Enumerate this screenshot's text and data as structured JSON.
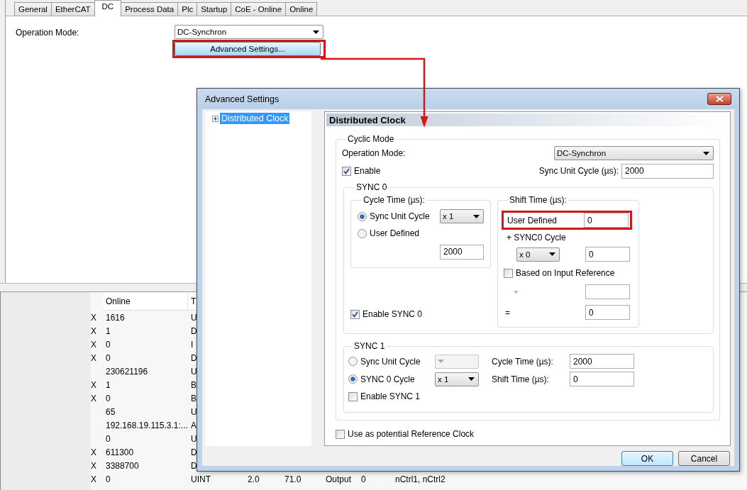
{
  "tabs": [
    {
      "label": "General",
      "selected": false
    },
    {
      "label": "EtherCAT",
      "selected": false
    },
    {
      "label": "DC",
      "selected": true
    },
    {
      "label": "Process Data",
      "selected": false
    },
    {
      "label": "Plc",
      "selected": false
    },
    {
      "label": "Startup",
      "selected": false
    },
    {
      "label": "CoE - Online",
      "selected": false
    },
    {
      "label": "Online",
      "selected": false
    }
  ],
  "dc_page": {
    "operation_mode_label": "Operation Mode:",
    "operation_mode": "DC-Synchron",
    "advanced_button": {
      "label": "Advanced Settings...",
      "highlighted": true
    }
  },
  "table": {
    "columns": [
      "Online",
      "T"
    ],
    "rows": [
      {
        "flag": "X",
        "cells": [
          "1616",
          "U"
        ]
      },
      {
        "flag": "X",
        "cells": [
          "1",
          "D"
        ]
      },
      {
        "flag": "X",
        "cells": [
          "0",
          "I"
        ]
      },
      {
        "flag": "X",
        "cells": [
          "0",
          "D"
        ]
      },
      {
        "cells": [
          "230621196",
          "U"
        ]
      },
      {
        "flag": "X",
        "cells": [
          "1",
          "B"
        ]
      },
      {
        "flag": "X",
        "cells": [
          "0",
          "B"
        ]
      },
      {
        "cells": [
          "65",
          "U"
        ]
      },
      {
        "cells": [
          "192.168.19.115.3.1:...",
          "A"
        ]
      },
      {
        "cells": [
          "0",
          "U"
        ]
      },
      {
        "flag": "X",
        "cells": [
          "611300",
          "D"
        ]
      },
      {
        "flag": "X",
        "cells": [
          "3388700",
          "D"
        ]
      },
      {
        "flag": "X",
        "cells": [
          "0",
          "UINT",
          "2.0",
          "71.0",
          "Output",
          "0",
          "nCtrl1, nCtrl2"
        ]
      }
    ]
  },
  "dialog": {
    "title": "Advanced Settings",
    "tree": [
      {
        "label": "Distributed Clock",
        "selected": true,
        "expanded": false
      }
    ],
    "panel_title": "Distributed Clock",
    "cyclic_mode": {
      "legend": "Cyclic Mode",
      "operation_mode_label": "Operation Mode:",
      "operation_mode": "DC-Synchron",
      "enable": {
        "label": "Enable",
        "checked": true
      },
      "sync_unit_cycle_label": "Sync Unit Cycle (µs):",
      "sync_unit_cycle": "2000"
    },
    "sync0": {
      "legend": "SYNC 0",
      "cycle_time": {
        "legend": "Cycle Time (µs):",
        "options": [
          {
            "label": "Sync Unit Cycle",
            "selected": true
          },
          {
            "label": "User Defined",
            "selected": false
          }
        ],
        "multiplier": "x 1",
        "user_value": "2000"
      },
      "enable": {
        "label": "Enable SYNC 0",
        "checked": true
      },
      "shift_time": {
        "legend": "Shift Time (µs):",
        "highlighted": true,
        "user_defined_label": "User Defined",
        "user_defined": "0",
        "sync0_cycle_label": "+ SYNC0 Cycle",
        "multiplier": "x 0",
        "sync0_value": "0",
        "input_reference": {
          "label": "Based on Input Reference",
          "checked": false
        },
        "plus": "+",
        "equals": "=",
        "total": "0"
      }
    },
    "sync1": {
      "legend": "SYNC 1",
      "options": [
        {
          "label": "Sync Unit Cycle",
          "selected": false,
          "multiplier": {
            "disabled": true
          }
        },
        {
          "label": "SYNC 0 Cycle",
          "selected": true,
          "multiplier": {
            "value": "x 1",
            "disabled": false
          }
        }
      ],
      "cycle_time_label": "Cycle Time (µs):",
      "cycle_time": "2000",
      "shift_time_label": "Shift Time (µs):",
      "shift_time": "0",
      "enable": {
        "label": "Enable SYNC 1",
        "checked": false
      }
    },
    "reference_clock": {
      "label": "Use as potential Reference Clock",
      "checked": false
    },
    "buttons": [
      {
        "label": "OK",
        "default": true
      },
      {
        "label": "Cancel",
        "default": false
      }
    ]
  }
}
